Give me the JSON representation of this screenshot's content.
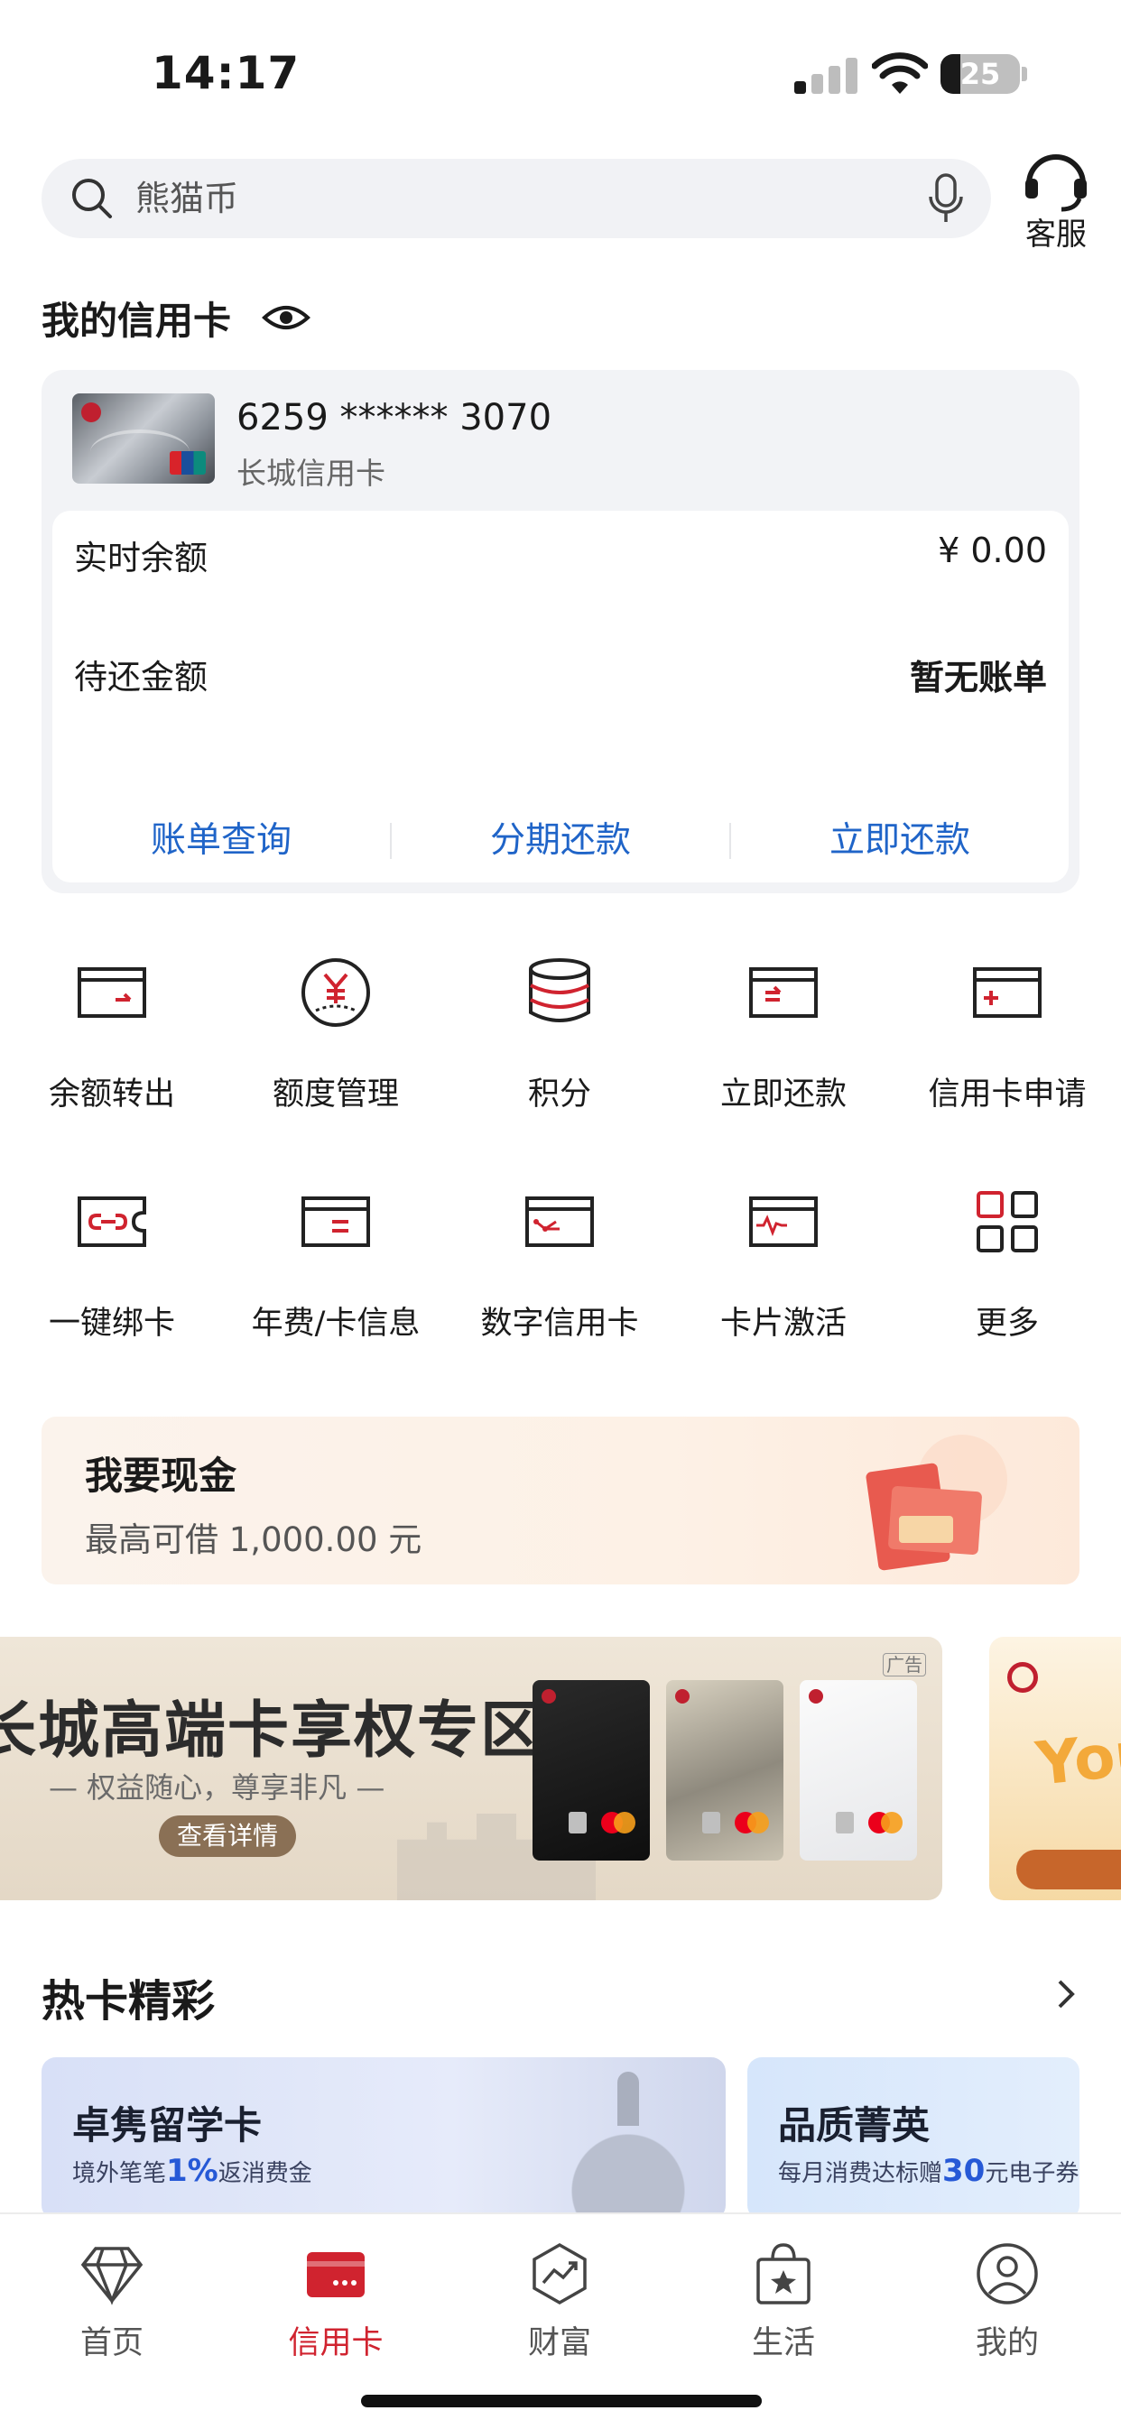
{
  "status_bar": {
    "time": "14:17",
    "battery": "25"
  },
  "search": {
    "placeholder": "熊猫币",
    "service_label": "客服"
  },
  "my_cards": {
    "title": "我的信用卡",
    "card_number": "6259 ****** 3070",
    "card_name": "长城信用卡",
    "balance_label": "实时余额",
    "balance_value": "¥ 0.00",
    "due_label": "待还金额",
    "due_value": "暂无账单",
    "actions": [
      "账单查询",
      "分期还款",
      "立即还款"
    ]
  },
  "grid": {
    "items": [
      {
        "label": "余额转出",
        "icon": "card-transfer-out-icon"
      },
      {
        "label": "额度管理",
        "icon": "yuan-limit-icon"
      },
      {
        "label": "积分",
        "icon": "points-stack-icon"
      },
      {
        "label": "立即还款",
        "icon": "card-repay-icon"
      },
      {
        "label": "信用卡申请",
        "icon": "card-apply-icon"
      },
      {
        "label": "一键绑卡",
        "icon": "card-bind-icon"
      },
      {
        "label": "年费/卡信息",
        "icon": "card-info-icon"
      },
      {
        "label": "数字信用卡",
        "icon": "digital-card-icon"
      },
      {
        "label": "卡片激活",
        "icon": "card-activate-icon"
      },
      {
        "label": "更多",
        "icon": "more-grid-icon"
      }
    ]
  },
  "cash": {
    "title": "我要现金",
    "subtitle": "最高可借 1,000.00 元"
  },
  "promo": {
    "title": "长城高端卡享权专区",
    "subtitle": "— 权益随心，尊享非凡 —",
    "button": "查看详情",
    "ad_tag": "广告",
    "second_text": "You"
  },
  "hot": {
    "title": "热卡精彩",
    "cards": [
      {
        "name": "卓隽留学卡",
        "desc_pre": "境外笔笔",
        "desc_em": "1%",
        "desc_post": "返消费金"
      },
      {
        "name": "品质菁英",
        "desc_pre": "每月消费达标赠",
        "desc_em": "30",
        "desc_post": "元电子券"
      }
    ]
  },
  "tabs": [
    {
      "label": "首页",
      "active": false
    },
    {
      "label": "信用卡",
      "active": true
    },
    {
      "label": "财富",
      "active": false
    },
    {
      "label": "生活",
      "active": false
    },
    {
      "label": "我的",
      "active": false
    }
  ],
  "colors": {
    "brand_red": "#d0232f",
    "link_blue": "#1f64c8"
  }
}
